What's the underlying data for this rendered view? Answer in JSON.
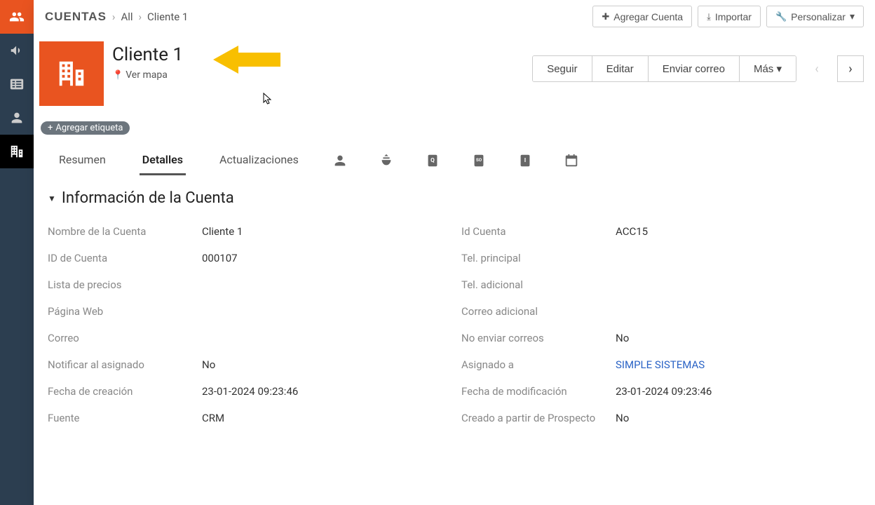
{
  "breadcrumb": {
    "module": "CUENTAS",
    "filter": "All",
    "record": "Cliente 1"
  },
  "topActions": {
    "add": "Agregar Cuenta",
    "import": "Importar",
    "customize": "Personalizar"
  },
  "header": {
    "title": "Cliente 1",
    "mapLink": "Ver mapa",
    "addTag": "Agregar etiqueta"
  },
  "recordActions": {
    "follow": "Seguir",
    "edit": "Editar",
    "sendEmail": "Enviar correo",
    "more": "Más"
  },
  "tabs": {
    "summary": "Resumen",
    "details": "Detalles",
    "updates": "Actualizaciones"
  },
  "section": {
    "title": "Información de la Cuenta",
    "left": [
      {
        "label": "Nombre de la Cuenta",
        "value": "Cliente 1"
      },
      {
        "label": "ID de Cuenta",
        "value": "000107"
      },
      {
        "label": "Lista de precios",
        "value": ""
      },
      {
        "label": "Página Web",
        "value": ""
      },
      {
        "label": "Correo",
        "value": ""
      },
      {
        "label": "Notificar al asignado",
        "value": "No"
      },
      {
        "label": "Fecha de creación",
        "value": "23-01-2024 09:23:46"
      },
      {
        "label": "Fuente",
        "value": "CRM"
      }
    ],
    "right": [
      {
        "label": "Id Cuenta",
        "value": "ACC15"
      },
      {
        "label": "Tel. principal",
        "value": ""
      },
      {
        "label": "Tel. adicional",
        "value": ""
      },
      {
        "label": "Correo adicional",
        "value": ""
      },
      {
        "label": "No enviar correos",
        "value": "No"
      },
      {
        "label": "Asignado a",
        "value": "SIMPLE SISTEMAS",
        "link": true
      },
      {
        "label": "Fecha de modificación",
        "value": "23-01-2024 09:23:46"
      },
      {
        "label": "Creado a partir de Prospecto",
        "value": "No"
      }
    ]
  }
}
